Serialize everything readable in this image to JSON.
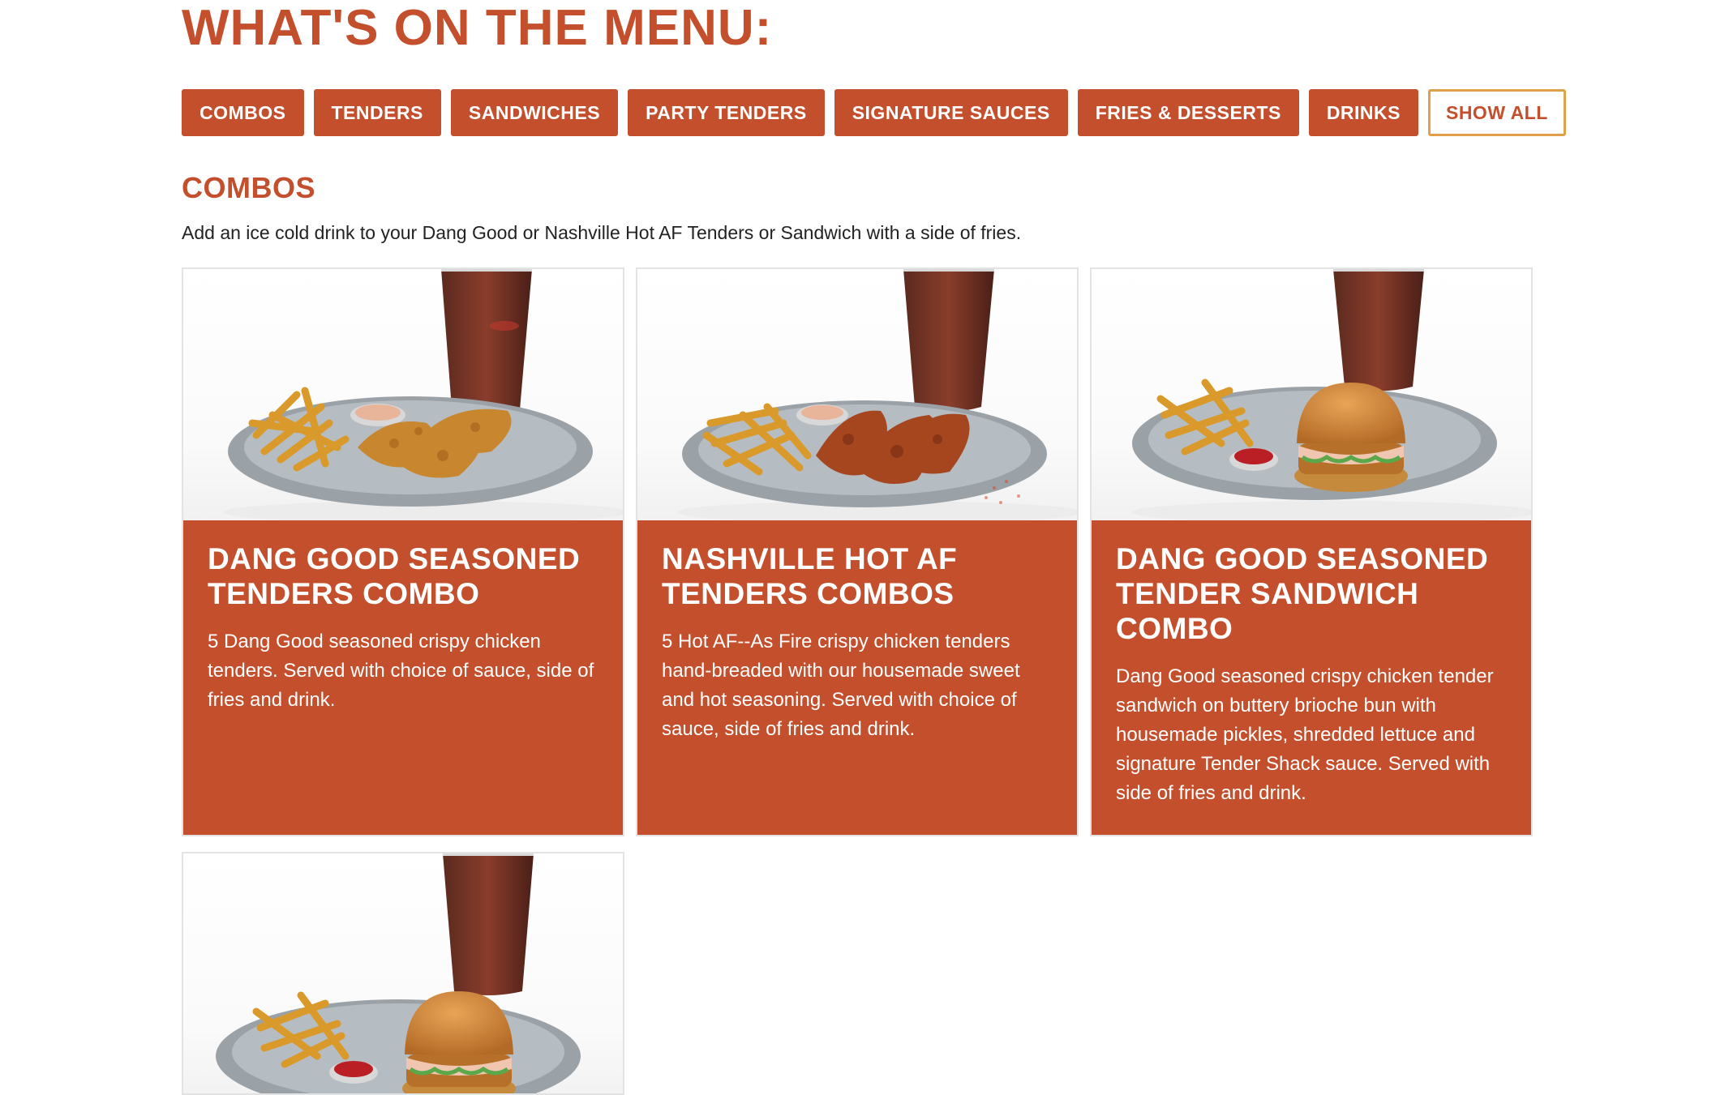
{
  "header": {
    "title": "WHAT'S ON THE MENU:"
  },
  "filters": [
    {
      "label": "COMBOS"
    },
    {
      "label": "TENDERS"
    },
    {
      "label": "SANDWICHES"
    },
    {
      "label": "PARTY TENDERS"
    },
    {
      "label": "SIGNATURE SAUCES"
    },
    {
      "label": "FRIES & DESSERTS"
    },
    {
      "label": "DRINKS"
    },
    {
      "label": "SHOW ALL"
    }
  ],
  "section": {
    "title": "COMBOS",
    "description": "Add an ice cold drink to your Dang Good or Nashville Hot AF Tenders or Sandwich with a side of fries."
  },
  "items": [
    {
      "title": "DANG GOOD SEASONED TENDERS COMBO",
      "description": "5 Dang Good seasoned crispy chicken tenders. Served with choice of sauce, side of fries and drink."
    },
    {
      "title": "NASHVILLE HOT AF TENDERS COMBOS",
      "description": "5 Hot AF--As Fire crispy chicken tenders hand-breaded with our housemade sweet and hot seasoning. Served with choice of sauce, side of fries and drink."
    },
    {
      "title": "DANG GOOD SEASONED TENDER SANDWICH COMBO",
      "description": "Dang Good seasoned crispy chicken tender sandwich on buttery brioche bun with housemade pickles, shredded lettuce and signature Tender Shack sauce. Served with side of fries and drink."
    }
  ],
  "colors": {
    "brand": "#c44f2c",
    "outline_button_border": "#e0a04a",
    "card_border": "#e3e3e3"
  },
  "icons": {
    "combo_photo": "food-photo-icon"
  }
}
